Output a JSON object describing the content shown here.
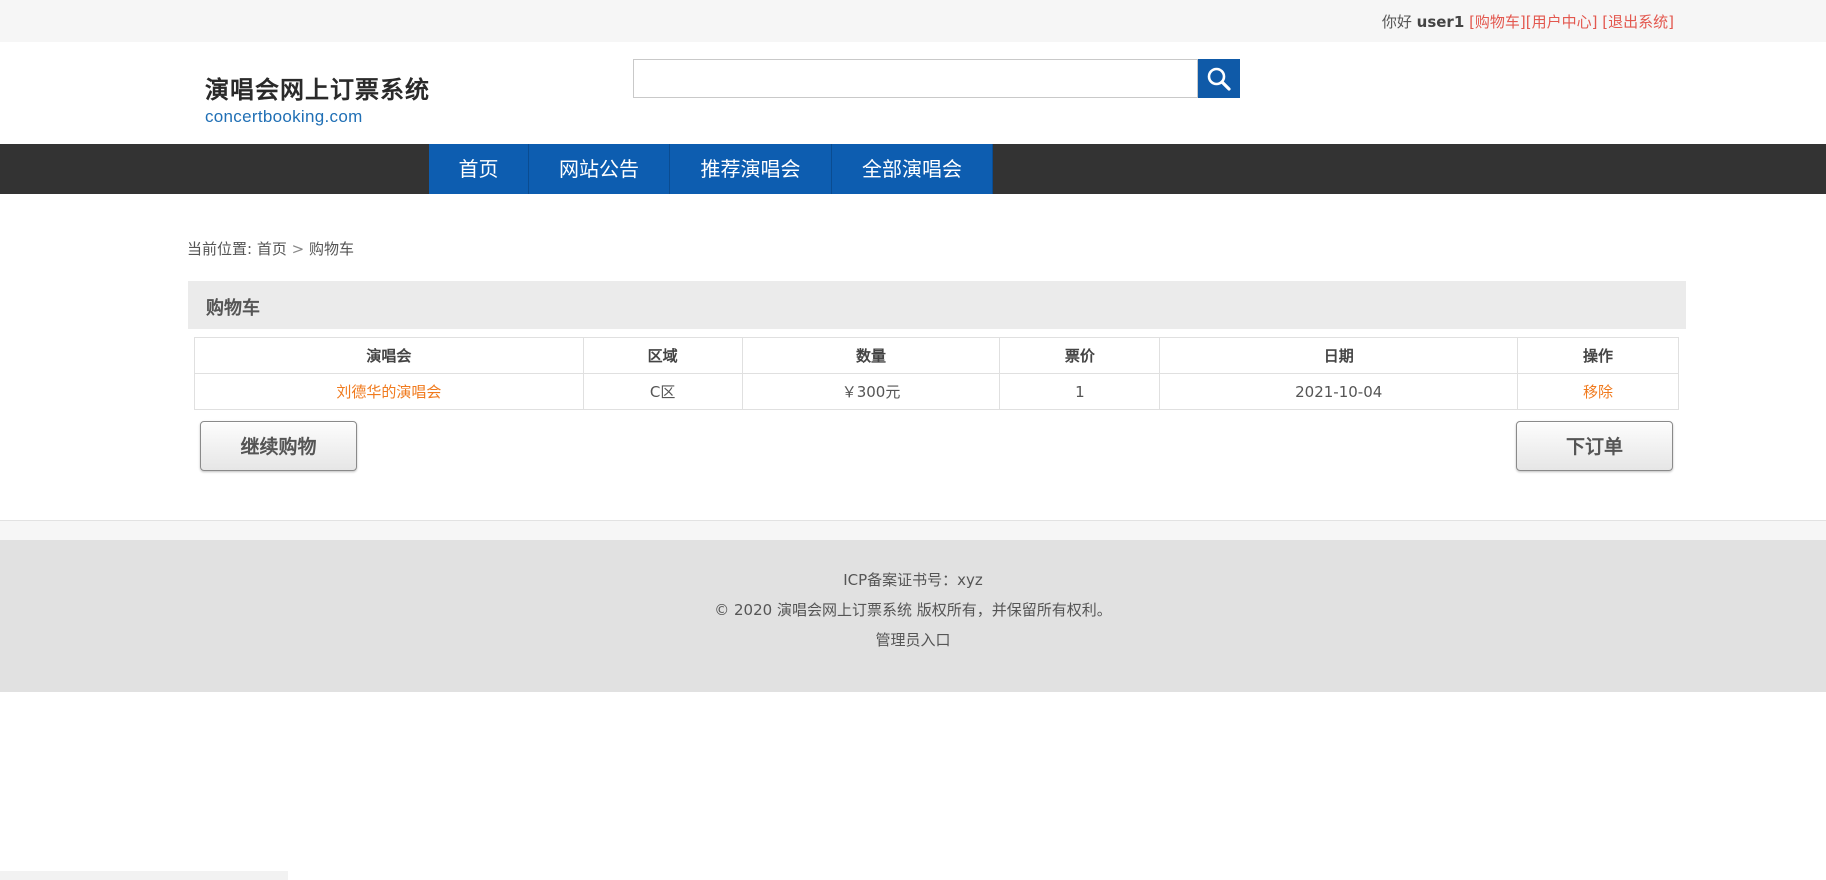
{
  "topbar": {
    "greeting": "你好",
    "username": "user1",
    "cart_link": "[购物车]",
    "user_center_link": "[用户中心]",
    "logout_link": "[退出系统]"
  },
  "header": {
    "logo_cn": "演唱会网上订票系统",
    "logo_en": "concertbooking.com",
    "search_value": ""
  },
  "nav": {
    "items": [
      "首页",
      "网站公告",
      "推荐演唱会",
      "全部演唱会"
    ]
  },
  "breadcrumb": {
    "prefix": "当前位置:",
    "home": "首页",
    "separator": ">",
    "current": "购物车"
  },
  "cart": {
    "title": "购物车",
    "columns": [
      "演唱会",
      "区域",
      "数量",
      "票价",
      "日期",
      "操作"
    ],
    "rows": [
      [
        "刘德华的演唱会",
        "C区",
        "￥300元",
        "1",
        "2021-10-04",
        "移除"
      ]
    ],
    "continue_label": "继续购物",
    "order_label": "下订单"
  },
  "footer": {
    "icp": "ICP备案证书号：xyz",
    "copyright": "© 2020 演唱会网上订票系统 版权所有，并保留所有权利。",
    "admin": "管理员入口"
  },
  "colors": {
    "nav_blue": "#0d5db0",
    "nav_bar": "#333333",
    "link_red": "#e3584f",
    "link_orange": "#f07a1d"
  }
}
